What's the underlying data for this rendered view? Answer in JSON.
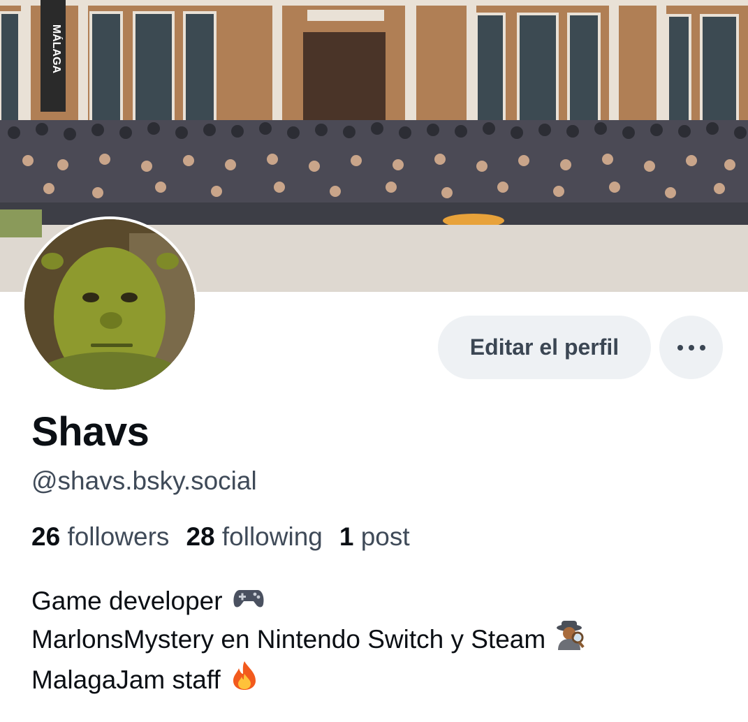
{
  "banner": {
    "sign_text": "MÁLAGA"
  },
  "profile": {
    "display_name": "Shavs",
    "handle": "@shavs.bsky.social"
  },
  "actions": {
    "edit_label": "Editar el perfil",
    "more_icon": "more-horizontal-icon"
  },
  "stats": {
    "followers_count": "26",
    "followers_label": "followers",
    "following_count": "28",
    "following_label": "following",
    "posts_count": "1",
    "posts_label": "post"
  },
  "bio": {
    "line1": "Game developer",
    "line1_icon": "gamepad-icon",
    "line2": "MarlonsMystery en Nintendo Switch y Steam",
    "line2_icon": "detective-icon",
    "line3": "MalagaJam staff",
    "line3_icon": "fire-icon"
  },
  "colors": {
    "button_bg": "#eef1f4",
    "muted_text": "#3f4a58",
    "primary_text": "#0b0f14"
  }
}
